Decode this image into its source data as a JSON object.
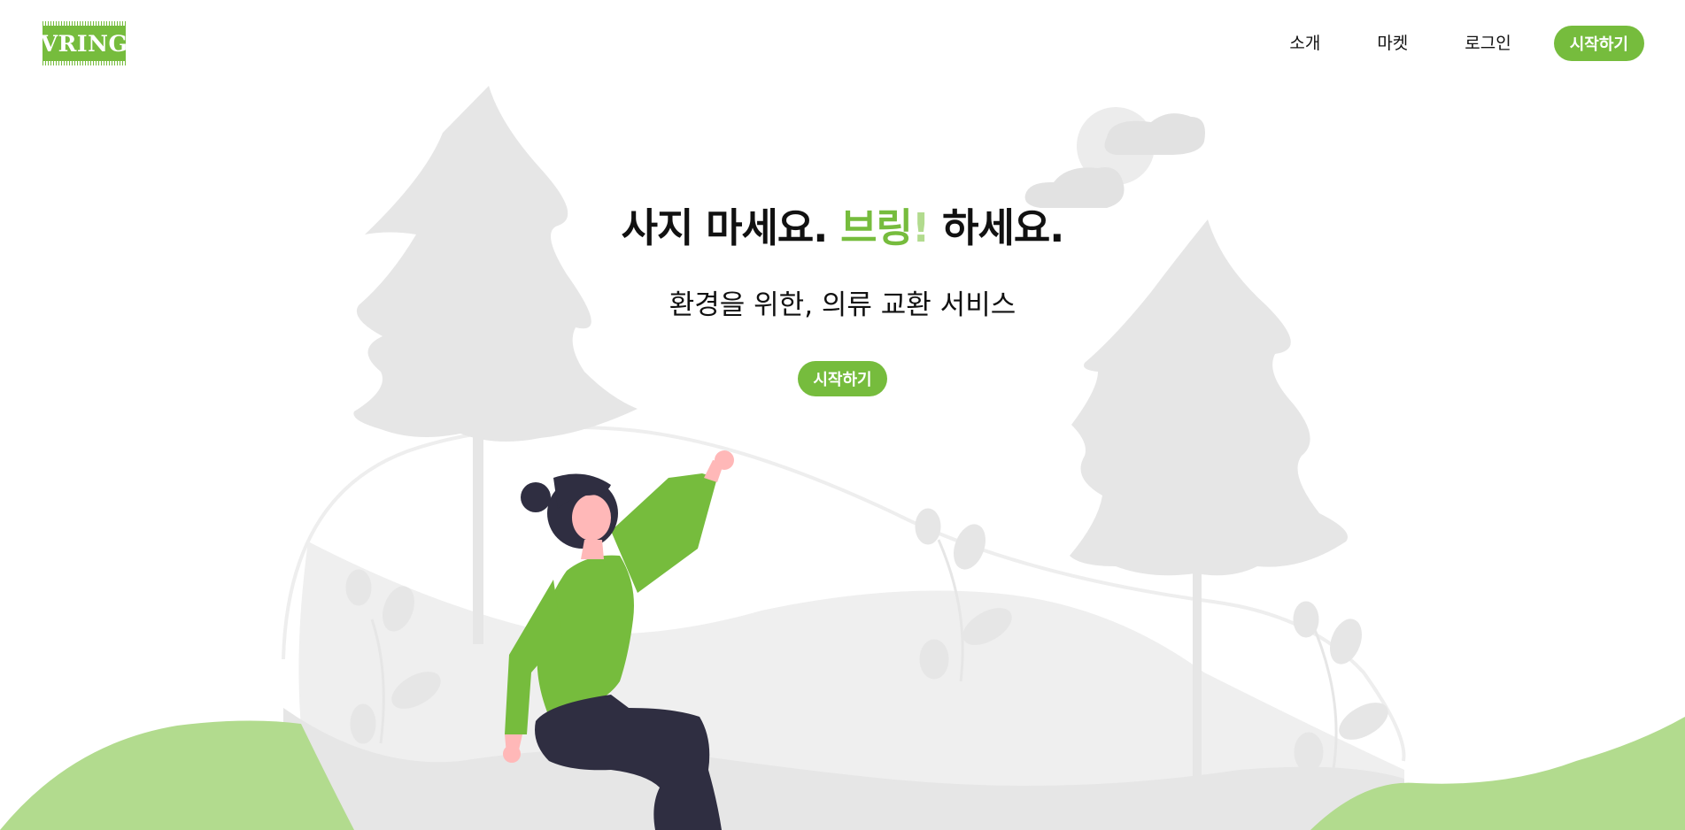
{
  "header": {
    "logo_text": "VRING",
    "nav": [
      {
        "label": "소개"
      },
      {
        "label": "마켓"
      },
      {
        "label": "로그인"
      }
    ],
    "start_button": "시작하기"
  },
  "hero": {
    "title_part1": "사지 마세요. ",
    "title_accent": "브링",
    "title_excl": "!",
    "title_part2": " 하세요.",
    "subtitle": "환경을 위한, 의류 교환 서비스",
    "cta": "시작하기"
  },
  "colors": {
    "brand_green": "#76bc3d",
    "light_green": "#b2db8e",
    "scenery_gray": "#e6e6e6"
  },
  "illustration": {
    "icons": [
      "pine-tree-icon",
      "cloud-icon",
      "sun-icon",
      "plant-icon",
      "person-icon"
    ]
  }
}
